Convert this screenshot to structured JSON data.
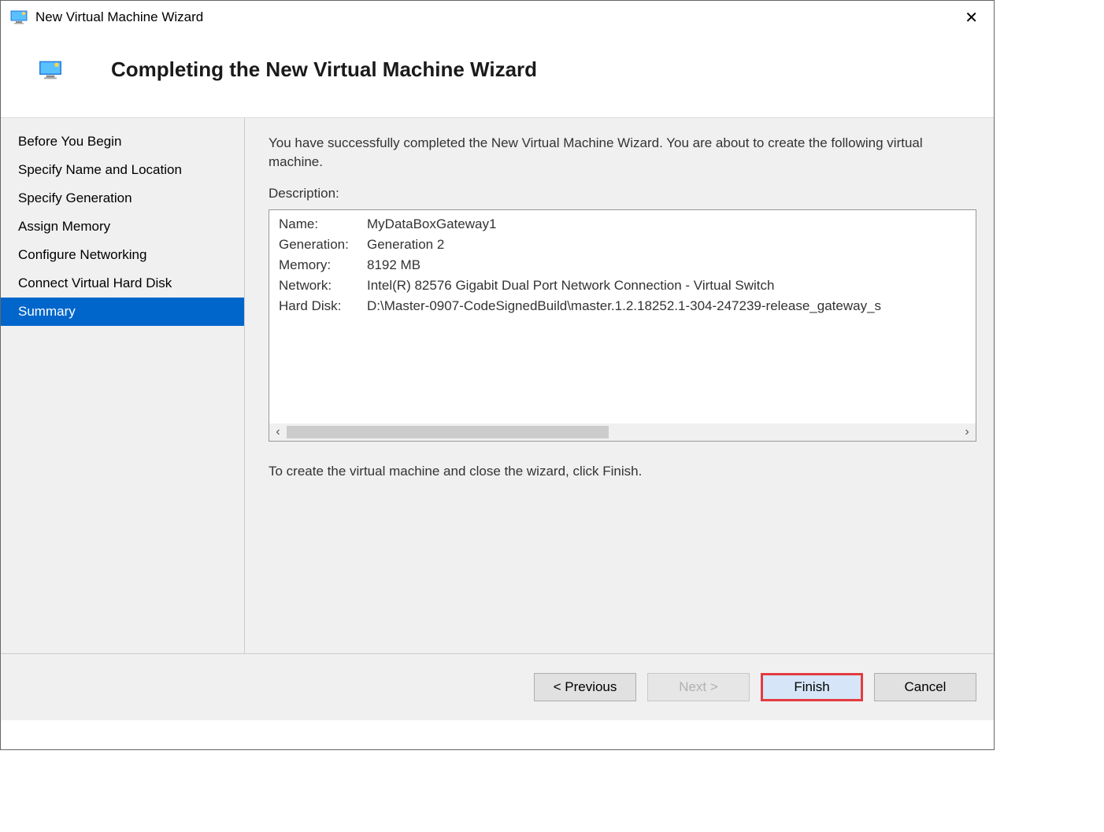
{
  "window": {
    "title": "New Virtual Machine Wizard"
  },
  "header": {
    "title": "Completing the New Virtual Machine Wizard"
  },
  "sidebar": {
    "steps": [
      {
        "label": "Before You Begin",
        "active": false
      },
      {
        "label": "Specify Name and Location",
        "active": false
      },
      {
        "label": "Specify Generation",
        "active": false
      },
      {
        "label": "Assign Memory",
        "active": false
      },
      {
        "label": "Configure Networking",
        "active": false
      },
      {
        "label": "Connect Virtual Hard Disk",
        "active": false
      },
      {
        "label": "Summary",
        "active": true
      }
    ]
  },
  "main": {
    "intro": "You have successfully completed the New Virtual Machine Wizard. You are about to create the following virtual machine.",
    "description_label": "Description:",
    "rows": [
      {
        "key": "Name:",
        "value": "MyDataBoxGateway1"
      },
      {
        "key": "Generation:",
        "value": "Generation 2"
      },
      {
        "key": "Memory:",
        "value": "8192 MB"
      },
      {
        "key": "Network:",
        "value": "Intel(R) 82576 Gigabit Dual Port Network Connection - Virtual Switch"
      },
      {
        "key": "Hard Disk:",
        "value": "D:\\Master-0907-CodeSignedBuild\\master.1.2.18252.1-304-247239-release_gateway_s"
      }
    ],
    "finish_note": "To create the virtual machine and close the wizard, click Finish."
  },
  "footer": {
    "previous": "< Previous",
    "next": "Next >",
    "finish": "Finish",
    "cancel": "Cancel"
  }
}
